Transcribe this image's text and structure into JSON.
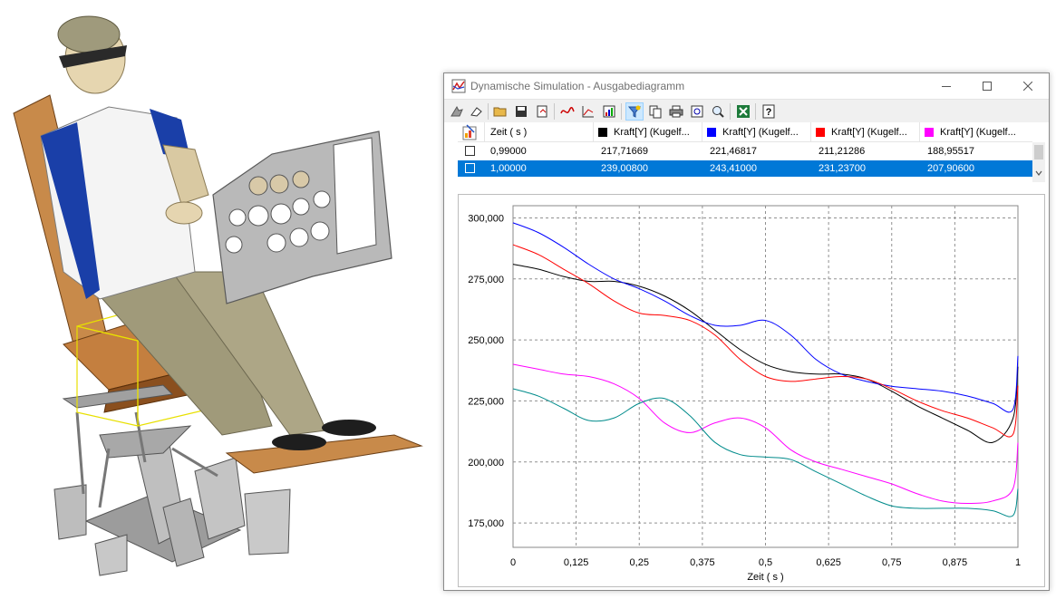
{
  "window": {
    "title": "Dynamische Simulation - Ausgabediagramm"
  },
  "toolbar": {
    "icons": [
      "assembly-icon",
      "eraser-icon",
      "open-folder-icon",
      "save-icon",
      "export-icon",
      "print-icon",
      "curve-icon",
      "axis-point-icon",
      "output-grapher-icon",
      "filter-icon",
      "copy-icon",
      "print-preview-icon",
      "zoom-fit-icon",
      "zoom-icon",
      "excel-export-icon",
      "help-icon"
    ]
  },
  "table": {
    "headers": [
      {
        "label": "Zeit ( s )",
        "color": ""
      },
      {
        "label": "Kraft[Y] (Kugelf...",
        "color": "#000000"
      },
      {
        "label": "Kraft[Y] (Kugelf...",
        "color": "#0000ff"
      },
      {
        "label": "Kraft[Y] (Kugelf...",
        "color": "#ff0000"
      },
      {
        "label": "Kraft[Y] (Kugelf...",
        "color": "#ff00ff"
      }
    ],
    "rows": [
      {
        "cells": [
          "0,99000",
          "217,71669",
          "221,46817",
          "211,21286",
          "188,95517"
        ],
        "selected": false
      },
      {
        "cells": [
          "1,00000",
          "239,00800",
          "243,41000",
          "231,23700",
          "207,90600"
        ],
        "selected": true
      }
    ]
  },
  "chart_data": {
    "type": "line",
    "xlabel": "Zeit ( s )",
    "ylabel": "",
    "xlim": [
      0,
      1
    ],
    "ylim": [
      165000,
      305000
    ],
    "grid": true,
    "x_ticks": [
      0,
      0.125,
      0.25,
      0.375,
      0.5,
      0.625,
      0.75,
      0.875,
      1
    ],
    "x_tick_labels": [
      "0",
      "0,125",
      "0,25",
      "0,375",
      "0,5",
      "0,625",
      "0,75",
      "0,875",
      "1"
    ],
    "y_ticks": [
      175000,
      200000,
      225000,
      250000,
      275000,
      300000
    ],
    "y_tick_labels": [
      "175,000",
      "200,000",
      "225,000",
      "250,000",
      "275,000",
      "300,000"
    ],
    "series": [
      {
        "color": "#000000",
        "x": [
          0,
          0.05,
          0.1,
          0.15,
          0.2,
          0.25,
          0.3,
          0.35,
          0.4,
          0.45,
          0.5,
          0.55,
          0.6,
          0.65,
          0.7,
          0.75,
          0.8,
          0.85,
          0.9,
          0.95,
          0.99,
          1.0
        ],
        "y": [
          281000,
          279000,
          276000,
          274000,
          274000,
          272000,
          268000,
          262000,
          254000,
          246000,
          240000,
          237000,
          236000,
          236000,
          234000,
          229000,
          223000,
          218000,
          213000,
          208000,
          217717,
          239008
        ]
      },
      {
        "color": "#0000ff",
        "x": [
          0,
          0.05,
          0.1,
          0.15,
          0.2,
          0.25,
          0.3,
          0.35,
          0.4,
          0.45,
          0.5,
          0.55,
          0.6,
          0.65,
          0.7,
          0.75,
          0.8,
          0.85,
          0.9,
          0.95,
          0.99,
          1.0
        ],
        "y": [
          298000,
          294000,
          288000,
          281000,
          275000,
          271000,
          266000,
          260000,
          256000,
          256000,
          258000,
          252000,
          242000,
          236000,
          233000,
          231000,
          230000,
          229000,
          227000,
          224000,
          221468,
          243410
        ]
      },
      {
        "color": "#ff0000",
        "x": [
          0,
          0.05,
          0.1,
          0.15,
          0.2,
          0.25,
          0.3,
          0.35,
          0.4,
          0.45,
          0.5,
          0.55,
          0.6,
          0.65,
          0.7,
          0.75,
          0.8,
          0.85,
          0.9,
          0.95,
          0.99,
          1.0
        ],
        "y": [
          289000,
          285000,
          279000,
          273000,
          266000,
          261000,
          260000,
          258000,
          252000,
          242000,
          235000,
          233000,
          234000,
          235000,
          234000,
          230000,
          225000,
          221000,
          218000,
          214000,
          211213,
          231237
        ]
      },
      {
        "color": "#ff00ff",
        "x": [
          0,
          0.05,
          0.1,
          0.15,
          0.2,
          0.25,
          0.3,
          0.35,
          0.4,
          0.45,
          0.5,
          0.55,
          0.6,
          0.65,
          0.7,
          0.75,
          0.8,
          0.85,
          0.9,
          0.95,
          0.99,
          1.0
        ],
        "y": [
          240000,
          238000,
          236000,
          235000,
          232000,
          226000,
          216000,
          212000,
          216000,
          218000,
          214000,
          205000,
          200000,
          197000,
          194000,
          191000,
          187000,
          184000,
          183000,
          184000,
          188955,
          207906
        ]
      },
      {
        "color": "#008b8b",
        "x": [
          0,
          0.05,
          0.1,
          0.15,
          0.2,
          0.25,
          0.3,
          0.35,
          0.4,
          0.45,
          0.5,
          0.55,
          0.6,
          0.65,
          0.7,
          0.75,
          0.8,
          0.85,
          0.9,
          0.95,
          0.99,
          1.0
        ],
        "y": [
          230000,
          227000,
          222000,
          217000,
          218000,
          224000,
          226000,
          219000,
          208000,
          203000,
          202000,
          201000,
          196000,
          191000,
          186000,
          182000,
          181000,
          181000,
          181000,
          180000,
          178000,
          189000
        ]
      }
    ]
  },
  "colors": {
    "selection": "#0078d7",
    "toolbar_bg": "#f0f0f0",
    "window_border": "#8a8a8a"
  }
}
